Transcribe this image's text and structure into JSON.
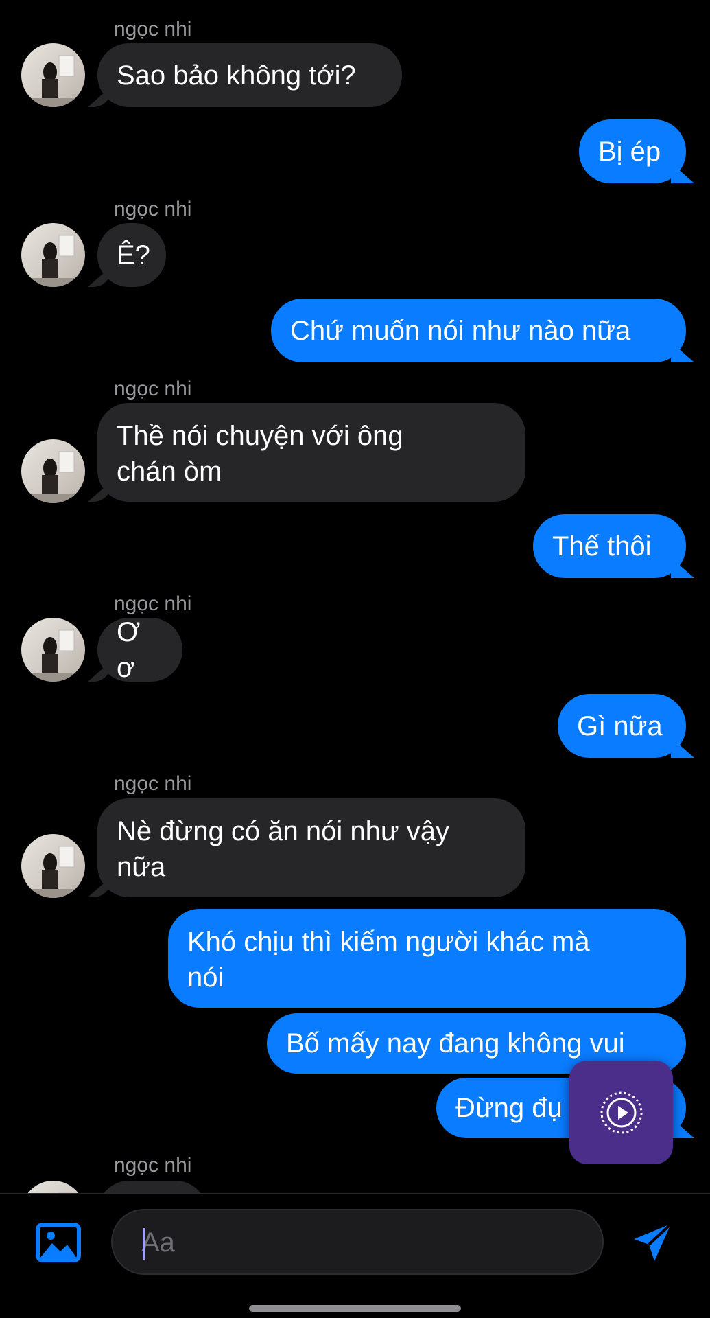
{
  "conversation": {
    "contact_name": "ngọc nhi",
    "messages": [
      {
        "side": "in",
        "sender": "ngọc nhi",
        "text": "Sao bảo không tới?"
      },
      {
        "side": "out",
        "text": "Bị ép"
      },
      {
        "side": "in",
        "sender": "ngọc nhi",
        "text": "Ê?"
      },
      {
        "side": "out",
        "text": "Chứ muốn nói như nào nữa"
      },
      {
        "side": "in",
        "sender": "ngọc nhi",
        "text": "Thề nói chuyện với ông\nchán òm"
      },
      {
        "side": "out",
        "text": "Thế thôi"
      },
      {
        "side": "in",
        "sender": "ngọc nhi",
        "text": "Ơ ơ"
      },
      {
        "side": "out",
        "text": "Gì nữa"
      },
      {
        "side": "in",
        "sender": "ngọc nhi",
        "text": "Nè đừng có ăn nói như vậy\nnữa"
      },
      {
        "side": "out",
        "text": "Khó chịu thì kiếm người khác mà\nnói"
      },
      {
        "side": "out",
        "text": "Bố mấy nay đang không vui"
      },
      {
        "side": "out",
        "text": "Đừng đụ"
      },
      {
        "side": "in",
        "sender": "ngọc nhi",
        "text": ""
      }
    ]
  },
  "composer": {
    "placeholder": "Aa",
    "photo_icon": "image-icon",
    "send_icon": "send-icon"
  },
  "overlay": {
    "icon": "play-circle-icon"
  },
  "colors": {
    "outgoing_bubble": "#0a7cff",
    "incoming_bubble": "#262628",
    "background": "#000000",
    "overlay_button": "#4b2d8a"
  }
}
